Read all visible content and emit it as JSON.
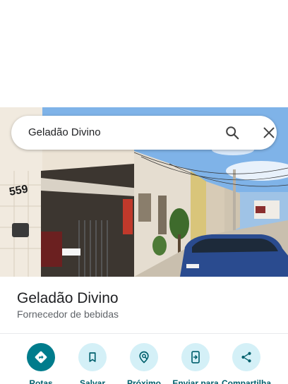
{
  "search": {
    "query": "Geladão Divino"
  },
  "place": {
    "name": "Geladão Divino",
    "category": "Fornecedor de bebidas"
  },
  "photo": {
    "house_number": "559"
  },
  "actions": [
    {
      "label": "Rotas",
      "icon": "directions-icon"
    },
    {
      "label": "Salvar",
      "icon": "bookmark-icon"
    },
    {
      "label": "Próximo",
      "icon": "nearby-icon"
    },
    {
      "label": "Enviar para",
      "icon": "send-to-device-icon"
    },
    {
      "label": "Compartilha",
      "icon": "share-icon"
    }
  ],
  "colors": {
    "primary": "#007c8c",
    "chip_bg": "#d4f0f7",
    "label": "#00606d"
  }
}
